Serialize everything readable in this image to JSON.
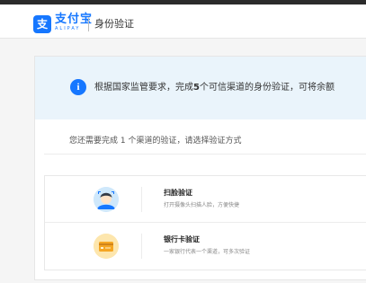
{
  "header": {
    "logo_glyph": "支",
    "brand_cn": "支付宝",
    "brand_en": "ALIPAY",
    "page_title": "身份验证"
  },
  "notice": {
    "text_before": "根据国家监管要求，完成",
    "count": "5",
    "text_after": "个可信渠道的身份验证，可将余额"
  },
  "prompt": "您还需要完成 1 个渠道的验证，请选择验证方式",
  "options": [
    {
      "title": "扫脸验证",
      "desc": "打开摄像头扫描人脸，方便快捷",
      "icon": "face-scan-icon"
    },
    {
      "title": "银行卡验证",
      "desc": "一家银行代表一个渠道，可多次验证",
      "icon": "bank-card-icon"
    }
  ],
  "colors": {
    "brand": "#1677ff",
    "notice_bg": "#eaf4fb",
    "card_icon_bg": "#fde6ad",
    "face_icon_bg": "#cfe8fb"
  }
}
